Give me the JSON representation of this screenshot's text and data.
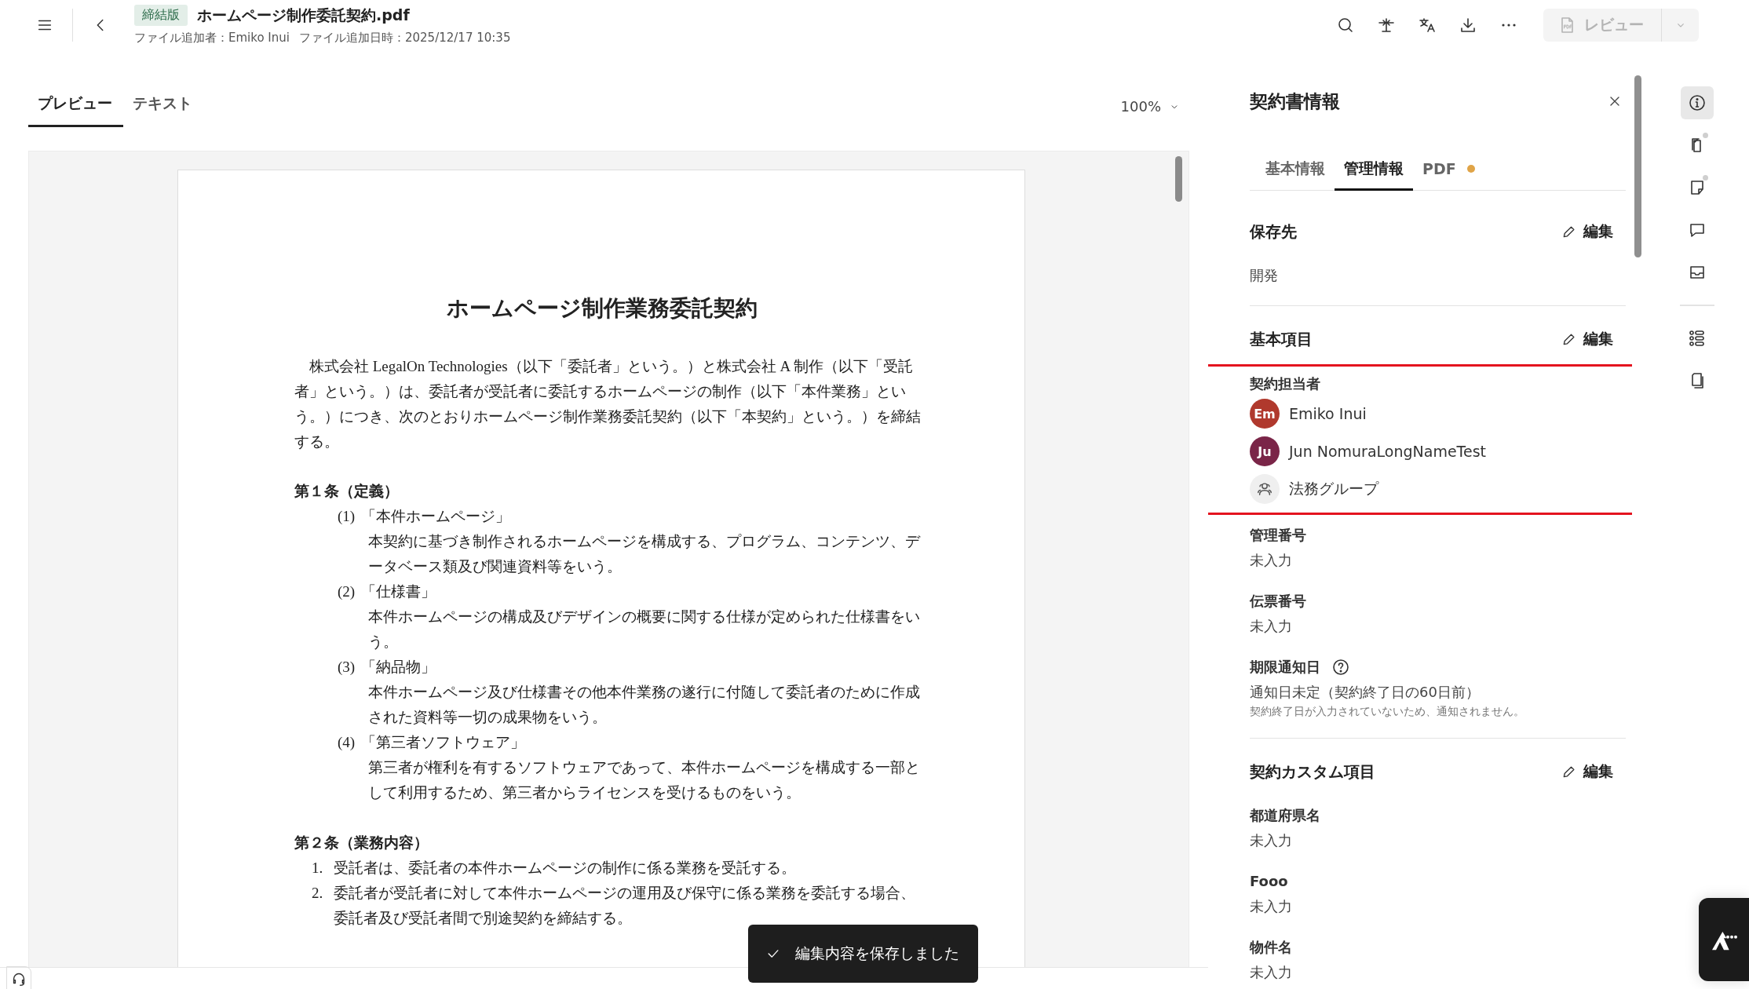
{
  "header": {
    "badge": "締結版",
    "filename": "ホームページ制作委託契約.pdf",
    "meta": [
      "ファイル追加者：Emiko Inui",
      "ファイル追加日時：2025/12/17 10:35"
    ],
    "tools": [
      {
        "kind": "search"
      },
      {
        "kind": "compare"
      },
      {
        "kind": "translate"
      },
      {
        "kind": "download"
      },
      {
        "kind": "more"
      }
    ],
    "review_button": {
      "label": "レビュー",
      "disabled": true
    }
  },
  "view_tabs": [
    {
      "label": "プレビュー",
      "selected": true
    },
    {
      "label": "テキスト",
      "selected": false
    }
  ],
  "zoom": "100%",
  "document": {
    "title": "ホームページ制作業務委託契約",
    "blocks": [
      {
        "kind": "body",
        "text": "株式会社 LegalOn Technologies（以下「委託者」という。）と株式会社 A 制作（以下「受託者」という。）は、委託者が受託者に委託するホームページの制作（以下「本件業務」という。）につき、次のとおりホームページ制作業務委託契約（以下「本契約」という。）を締結する。"
      },
      {
        "kind": "heading",
        "text": "第１条（定義）"
      },
      {
        "kind": "item",
        "number": "(1)",
        "term": "「本件ホームページ」",
        "text": "本契約に基づき制作されるホームページを構成する、プログラム、コンテンツ、データベース類及び関連資料等をいう。"
      },
      {
        "kind": "item",
        "number": "(2)",
        "term": "「仕様書」",
        "text": "本件ホームページの構成及びデザインの概要に関する仕様が定められた仕様書をいう。"
      },
      {
        "kind": "item",
        "number": "(3)",
        "term": "「納品物」",
        "text": "本件ホームページ及び仕様書その他本件業務の遂行に付随して委託者のために作成された資料等一切の成果物をいう。"
      },
      {
        "kind": "item",
        "number": "(4)",
        "term": "「第三者ソフトウェア」",
        "text": "第三者が権利を有するソフトウェアであって、本件ホームページを構成する一部として利用するため、第三者からライセンスを受けるものをいう。"
      },
      {
        "kind": "heading",
        "text": "第２条（業務内容）"
      },
      {
        "kind": "numbered",
        "number": "1.",
        "text": "受託者は、委託者の本件ホームページの制作に係る業務を受託する。"
      },
      {
        "kind": "numbered",
        "number": "2.",
        "text": "委託者が受託者に対して本件ホームページの運用及び保守に係る業務を委託する場合、委託者及び受託者間で別途契約を締結する。"
      }
    ]
  },
  "toast": "編集内容を保存しました",
  "panel": {
    "title": "契約書情報",
    "tabs": [
      {
        "label": "基本情報",
        "selected": false,
        "dot": false
      },
      {
        "label": "管理情報",
        "selected": true,
        "dot": false
      },
      {
        "label": "PDF",
        "selected": false,
        "dot": true
      }
    ],
    "sections": [
      {
        "title": "保存先",
        "edit": "編集",
        "fields": [
          {
            "kind": "plain",
            "value": "開発"
          }
        ]
      },
      {
        "title": "基本項目",
        "edit": "編集",
        "fields": [
          {
            "kind": "people",
            "label": "契約担当者",
            "highlighted": true,
            "people": [
              {
                "kind": "user",
                "initials": "Em",
                "name": "Emiko Inui",
                "color": "#b0392d"
              },
              {
                "kind": "user",
                "initials": "Ju",
                "name": "Jun NomuraLongNameTest",
                "color": "#7a2548"
              },
              {
                "kind": "group",
                "name": "法務グループ"
              }
            ]
          },
          {
            "kind": "plain",
            "label": "管理番号",
            "value": "未入力"
          },
          {
            "kind": "plain",
            "label": "伝票番号",
            "value": "未入力"
          },
          {
            "kind": "plain",
            "label": "期限通知日",
            "help": true,
            "value": "通知日未定（契約終了日の60日前）",
            "note": "契約終了日が入力されていないため、通知されません。"
          }
        ]
      },
      {
        "title": "契約カスタム項目",
        "edit": "編集",
        "fields": [
          {
            "kind": "plain",
            "label": "都道府県名",
            "value": "未入力"
          },
          {
            "kind": "plain",
            "label": "Fooo",
            "value": "未入力"
          },
          {
            "kind": "plain",
            "label": "物件名",
            "value": "未入力"
          }
        ]
      }
    ]
  },
  "rail": [
    {
      "kind": "info",
      "selected": true
    },
    {
      "kind": "files",
      "selected": false,
      "dot": true
    },
    {
      "kind": "note",
      "selected": false,
      "dot": true
    },
    {
      "kind": "comment",
      "selected": false
    },
    {
      "kind": "inbox",
      "selected": false
    },
    {
      "kind": "divider"
    },
    {
      "kind": "list",
      "selected": false
    },
    {
      "kind": "copy",
      "selected": false
    }
  ]
}
